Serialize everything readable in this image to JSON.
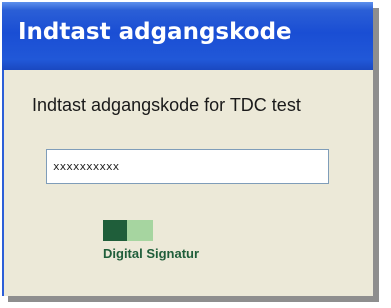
{
  "dialog": {
    "title": "Indtast adgangskode",
    "prompt": "Indtast adgangskode for TDC test",
    "password_value": "xxxxxxxxxx"
  },
  "logo": {
    "text": "Digital Signatur",
    "colors": {
      "dark": "#1f5e3a",
      "light": "#a6d5a0"
    }
  },
  "colors": {
    "titlebar": "#1a4ed4",
    "background": "#ece9d8"
  }
}
